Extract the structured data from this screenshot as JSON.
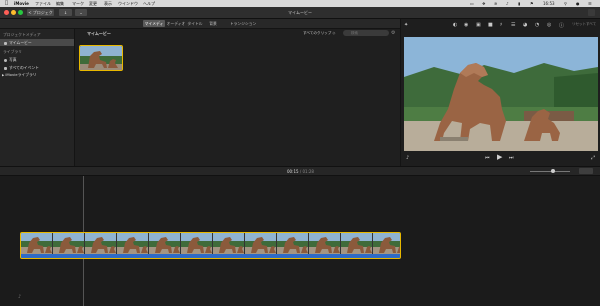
{
  "menubar": {
    "app_name": "iMovie",
    "items": [
      "ファイル",
      "編集",
      "マーク",
      "変更",
      "表示",
      "ウインドウ",
      "ヘルプ"
    ],
    "clock": "16:53"
  },
  "toolbar": {
    "back_label": "< プロジェクト",
    "window_title": "マイムービー"
  },
  "browser_tabs": [
    "マイメディア",
    "オーディオ",
    "タイトル",
    "背景",
    "トランジション"
  ],
  "sidebar": {
    "project_heading": "プロジェクトメディア",
    "project_item": "マイムービー",
    "library_heading": "ライブラリ",
    "photos_item": "写真",
    "events_item": "すべてのイベント",
    "imovie_library": "iMovieライブラリ"
  },
  "browser": {
    "title": "マイムービー",
    "filter": "すべてのクリップ ◇",
    "search_placeholder": "検索"
  },
  "viewer": {
    "reset_all": "リセットすべて",
    "tool_icons": [
      "magic-wand-icon",
      "color-balance-icon",
      "color-correction-icon",
      "crop-icon",
      "stabilization-icon",
      "volume-icon",
      "equalizer-icon",
      "speed-icon",
      "noise-reduction-icon",
      "clip-filter-icon",
      "info-icon"
    ]
  },
  "timeline": {
    "current_time": "00:15",
    "duration": "01:28"
  },
  "colors": {
    "selection": "#e8b800",
    "audio": "#2f6bc6",
    "menubar": "#d9d9d9"
  }
}
